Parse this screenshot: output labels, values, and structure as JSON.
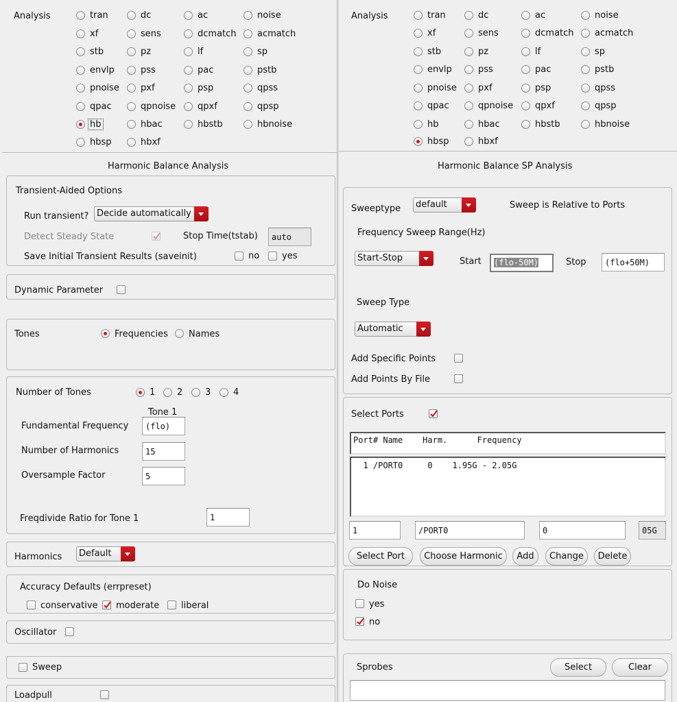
{
  "left": {
    "analysis_label": "Analysis",
    "analysis_options": [
      "tran",
      "dc",
      "ac",
      "noise",
      "xf",
      "sens",
      "dcmatch",
      "acmatch",
      "stb",
      "pz",
      "lf",
      "sp",
      "envlp",
      "pss",
      "pac",
      "pstb",
      "pnoise",
      "pxf",
      "psp",
      "qpss",
      "qpac",
      "qpnoise",
      "qpxf",
      "qpsp",
      "hb",
      "hbac",
      "hbstb",
      "hbnoise",
      "hbsp",
      "hbxf"
    ],
    "analysis_selected": "hb",
    "section_title": "Harmonic Balance Analysis",
    "transient": {
      "title": "Transient-Aided Options",
      "run_label": "Run transient?",
      "run_value": "Decide automatically",
      "detect_label": "Detect Steady State",
      "detect_checked": true,
      "stop_label": "Stop Time(tstab)",
      "stop_value": "auto",
      "save_label": "Save Initial Transient Results (saveinit)",
      "save_no": "no",
      "save_yes": "yes"
    },
    "dynamic_label": "Dynamic Parameter",
    "tones": {
      "label": "Tones",
      "frequencies": "Frequencies",
      "names": "Names",
      "selected": "Frequencies"
    },
    "num_tones": {
      "label": "Number of Tones",
      "options": [
        "1",
        "2",
        "3",
        "4"
      ],
      "selected": "1",
      "tone_header": "Tone 1",
      "fund_label": "Fundamental Frequency",
      "fund_value": "(flo)",
      "harm_label": "Number of Harmonics",
      "harm_value": "15",
      "over_label": "Oversample Factor",
      "over_value": "5",
      "freqdiv_label": "Freqdivide Ratio for Tone 1",
      "freqdiv_value": "1"
    },
    "harmonics": {
      "label": "Harmonics",
      "value": "Default"
    },
    "accuracy": {
      "label": "Accuracy Defaults (errpreset)",
      "conservative": "conservative",
      "moderate": "moderate",
      "liberal": "liberal",
      "selected": "moderate"
    },
    "oscillator_label": "Oscillator",
    "sweep_label": "Sweep",
    "loadpull_label": "Loadpull"
  },
  "right": {
    "analysis_label": "Analysis",
    "analysis_selected": "hbsp",
    "section_title": "Harmonic Balance SP Analysis",
    "sweeptype_label": "Sweeptype",
    "sweeptype_value": "default",
    "sweep_relative": "Sweep is Relative to Ports",
    "freq_range_label": "Frequency Sweep Range(Hz)",
    "range_mode": "Start-Stop",
    "start_label": "Start",
    "start_value": "(flo-50M)",
    "stop_label": "Stop",
    "stop_value": "(flo+50M)",
    "sweep_type_label": "Sweep Type",
    "sweep_type_value": "Automatic",
    "add_specific": "Add Specific Points",
    "add_by_file": "Add Points By File",
    "select_ports_label": "Select Ports",
    "select_ports_checked": true,
    "ports_header": "Port# Name    Harm.      Frequency",
    "ports_rows": [
      "  1 /PORT0     0    1.95G - 2.05G"
    ],
    "port_num": "1",
    "port_name": "/PORT0",
    "port_harm": "0",
    "port_freq": "05G",
    "buttons": {
      "select_port": "Select Port",
      "choose_harmonic": "Choose Harmonic",
      "add": "Add",
      "change": "Change",
      "delete": "Delete"
    },
    "do_noise": {
      "label": "Do Noise",
      "yes": "yes",
      "no": "no",
      "selected": "no"
    },
    "sprobes": {
      "label": "Sprobes",
      "select": "Select",
      "clear": "Clear",
      "value": ""
    }
  },
  "colors": {
    "accent": "#c9151e",
    "panel": "#efefef",
    "border": "#b9b9b9"
  }
}
